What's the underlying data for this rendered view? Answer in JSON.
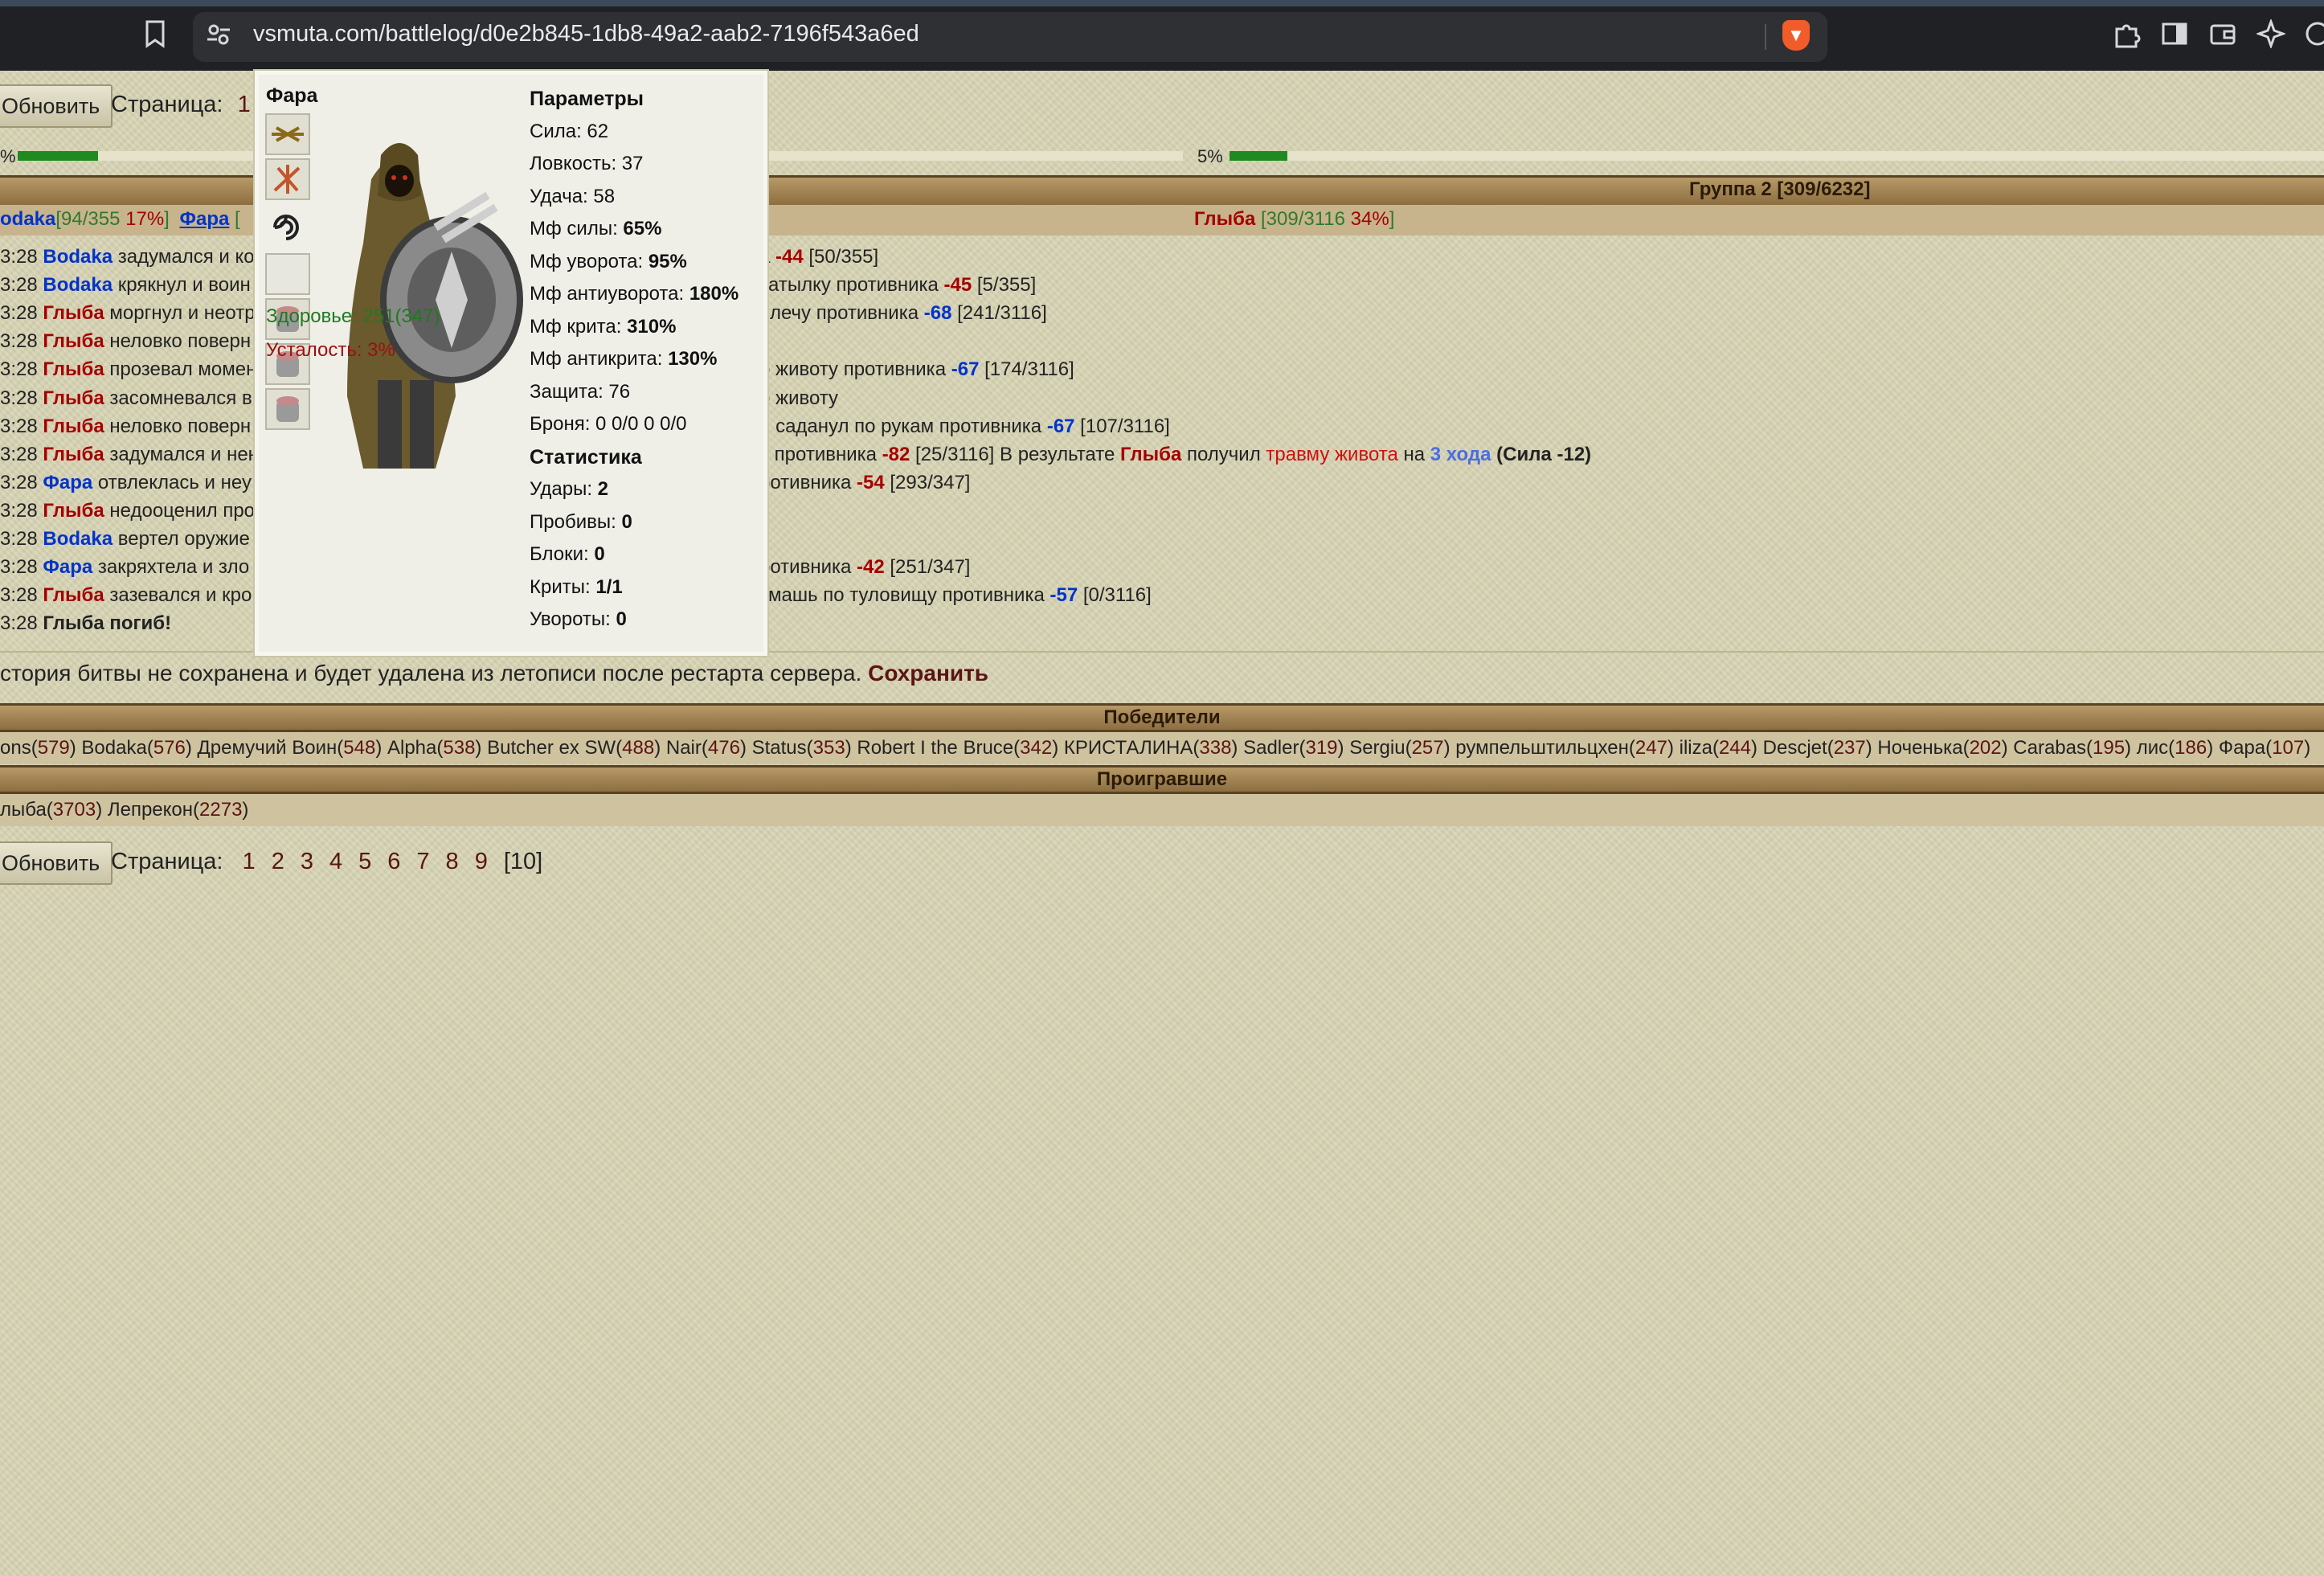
{
  "browser": {
    "url": "vsmuta.com/battlelog/d0e2b845-1db8-49a2-aab2-7196f543a6ed"
  },
  "toolbar": {
    "refresh_label": "Обновить",
    "page_label": "Страница:",
    "top_current_page": "1",
    "pages": [
      "1",
      "2",
      "3",
      "4",
      "5",
      "6",
      "7",
      "8",
      "9",
      "[10]"
    ]
  },
  "hp": {
    "left_percent_text": "%",
    "right_percent_text": "5%",
    "left_fill": 0.6,
    "right_fill": 0.5
  },
  "groups": {
    "group2_title": "Группа 2 [309/6232]"
  },
  "players_row": {
    "left_name": "odaka",
    "left_stats": "[94/355 ",
    "left_pct": "17%",
    "left_close": "]",
    "second_name": "Фара",
    "second_rest": " [",
    "right_name": "Глыба",
    "right_stats": " [309/3116 ",
    "right_pct": "34%",
    "right_close": "]"
  },
  "log": [
    {
      "time": "3:28",
      "actor": "Bodaka",
      "actor_color": "blue",
      "text": " задумался и ко",
      "tail_pre": "а ",
      "dmg": "-44",
      "dmg_color": "red",
      "tail": " [50/355]"
    },
    {
      "time": "3:28",
      "actor": "Bodaka",
      "actor_color": "blue",
      "text": " крякнул и воин",
      "tail_pre": "затылку противника ",
      "dmg": "-45",
      "dmg_color": "red",
      "tail": " [5/355]"
    },
    {
      "time": "3:28",
      "actor": "Глыба",
      "actor_color": "red",
      "text": " моргнул и неотр",
      "tail_pre": " плечу противника ",
      "dmg": "-68",
      "dmg_color": "blue",
      "tail": " [241/3116]"
    },
    {
      "time": "3:28",
      "actor": "Глыба",
      "actor_color": "red",
      "text": " неловко поверн",
      "tail_pre": "",
      "dmg": "",
      "dmg_color": "red",
      "tail": ""
    },
    {
      "time": "3:28",
      "actor": "Глыба",
      "actor_color": "red",
      "text": " прозевал момен",
      "tail_pre": "о животу противника ",
      "dmg": "-67",
      "dmg_color": "blue",
      "tail": " [174/3116]"
    },
    {
      "time": "3:28",
      "actor": "Глыба",
      "actor_color": "red",
      "text": " засомневался в",
      "tail_pre": "о животу",
      "dmg": "",
      "dmg_color": "red",
      "tail": ""
    },
    {
      "time": "3:28",
      "actor": "Глыба",
      "actor_color": "red",
      "text": " неловко поверн",
      "tail_pre": "и саданул по рукам противника ",
      "dmg": "-67",
      "dmg_color": "blue",
      "tail": " [107/3116]"
    },
    {
      "time": "3:28",
      "actor": "Глыба",
      "actor_color": "red",
      "text": " задумался и нен",
      "tail_pre": "у противника ",
      "dmg": "-82",
      "dmg_color": "red",
      "tail": " [25/3116] В результате "
    },
    {
      "time": "3:28",
      "actor": "Фара",
      "actor_color": "blue",
      "text": " отвлеклась и неу",
      "tail_pre": "ротивника ",
      "dmg": "-54",
      "dmg_color": "red",
      "tail": " [293/347]"
    },
    {
      "time": "3:28",
      "actor": "Глыба",
      "actor_color": "red",
      "text": " недооценил про",
      "tail_pre": "",
      "dmg": "",
      "dmg_color": "red",
      "tail": ""
    },
    {
      "time": "3:28",
      "actor": "Bodaka",
      "actor_color": "blue",
      "text": " вертел оружие",
      "tail_pre": "",
      "dmg": "",
      "dmg_color": "red",
      "tail": ""
    },
    {
      "time": "3:28",
      "actor": "Фара",
      "actor_color": "blue",
      "text": " закряхтела и зло",
      "tail_pre": "ротивника ",
      "dmg": "-42",
      "dmg_color": "red",
      "tail": " [251/347]"
    },
    {
      "time": "3:28",
      "actor": "Глыба",
      "actor_color": "red",
      "text": " зазевался и кро",
      "tail_pre": "змашь по туловищу противника ",
      "dmg": "-57",
      "dmg_color": "blue",
      "tail": " [0/3116]"
    },
    {
      "time": "3:28",
      "actor": "Глыба погиб!",
      "actor_color": "dark",
      "text": "",
      "tail_pre": "",
      "dmg": "",
      "dmg_color": "red",
      "tail": ""
    }
  ],
  "trauma_line": {
    "actor": "Глыба",
    "got": " получил ",
    "trauma": "травму живота",
    "on": " на ",
    "turns": "3 хода",
    "effect": " (Сила -12)"
  },
  "save_notice": {
    "text": "стория битвы не сохранена и будет удалена из летописи после рестарта сервера. ",
    "link": "Сохранить"
  },
  "winners": {
    "title": "Победители",
    "items": [
      {
        "name": "ons",
        "score": "579"
      },
      {
        "name": "Bodaka",
        "score": "576"
      },
      {
        "name": "Дремучий Воин",
        "score": "548"
      },
      {
        "name": "Alpha",
        "score": "538"
      },
      {
        "name": "Butcher ex SW",
        "score": "488"
      },
      {
        "name": "Nair",
        "score": "476"
      },
      {
        "name": "Status",
        "score": "353"
      },
      {
        "name": "Robert I the Bruce",
        "score": "342"
      },
      {
        "name": "КРИСТАЛИНА",
        "score": "338"
      },
      {
        "name": "Sadler",
        "score": "319"
      },
      {
        "name": "Sergiu",
        "score": "257"
      },
      {
        "name": "румпельштильцхен",
        "score": "247"
      },
      {
        "name": "iliza",
        "score": "244"
      },
      {
        "name": "Descjet",
        "score": "237"
      },
      {
        "name": "Ноченька",
        "score": "202"
      },
      {
        "name": "Carabas",
        "score": "195"
      },
      {
        "name": "лис",
        "score": "186"
      },
      {
        "name": "Фара",
        "score": "107"
      }
    ]
  },
  "losers": {
    "title": "Проигравшие",
    "items": [
      {
        "name": "лыба",
        "score": "3703"
      },
      {
        "name": "Лепрекон",
        "score": "2273"
      }
    ]
  },
  "popup": {
    "name": "Фара",
    "health": "Здоровье: 251(347)",
    "fatigue": "Усталость: 3%",
    "params_title": "Параметры",
    "strength": "Сила: 62",
    "agility": "Ловкость: 37",
    "luck": "Удача: 58",
    "mf_strength_label": "Мф силы: ",
    "mf_strength": "65%",
    "mf_dodge_label": "Мф уворота: ",
    "mf_dodge": "95%",
    "mf_antidodge_label": "Мф антиуворота: ",
    "mf_antidodge": "180%",
    "mf_crit_label": "Мф крита: ",
    "mf_crit": "310%",
    "mf_anticrit_label": "Мф антикрита: ",
    "mf_anticrit": "130%",
    "defense": "Защита: 76",
    "armor": "Броня: 0 0/0 0 0/0",
    "stats_title": "Статистика",
    "hits_label": "Удары: ",
    "hits": "2",
    "pierces_label": "Пробивы: ",
    "pierces": "0",
    "blocks_label": "Блоки: ",
    "blocks": "0",
    "crits_label": "Криты: ",
    "crits": "1/1",
    "dodges_label": "Увороты: ",
    "dodges": "0"
  },
  "colors": {
    "blue_player": "#0033cc",
    "red_player": "#a40000",
    "hp_green": "#1f8a1f",
    "dark_red_link": "#5a1414"
  }
}
